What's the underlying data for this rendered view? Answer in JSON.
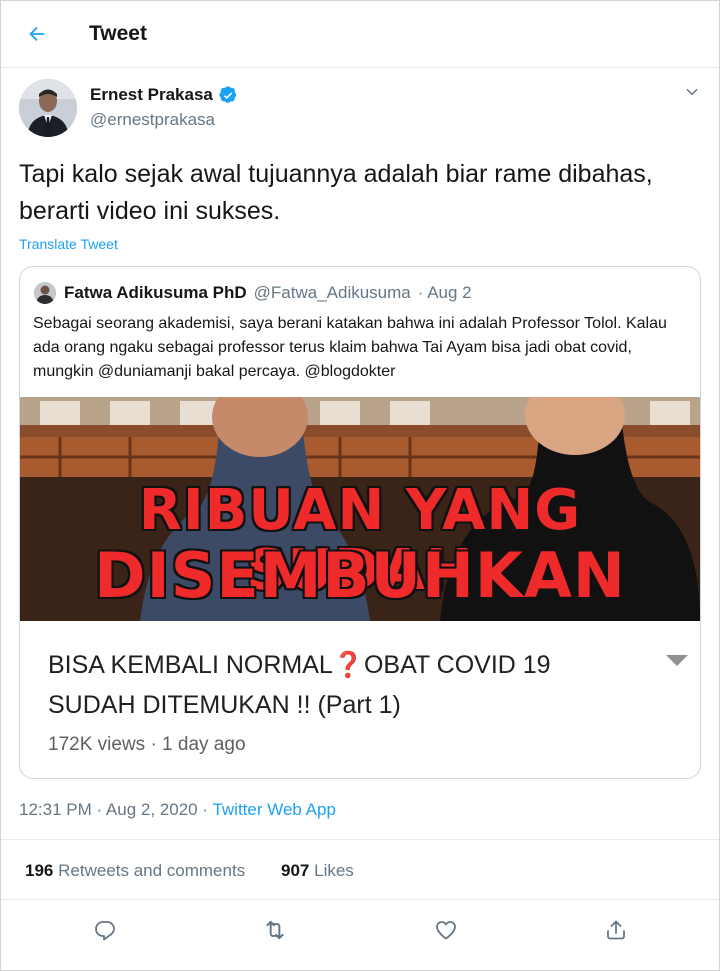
{
  "header": {
    "title": "Tweet"
  },
  "author": {
    "name": "Ernest Prakasa",
    "handle": "@ernestprakasa"
  },
  "tweet": {
    "text": "Tapi kalo sejak awal tujuannya adalah biar rame dibahas, berarti video ini sukses.",
    "translate_label": "Translate Tweet"
  },
  "quoted": {
    "name": "Fatwa Adikusuma PhD",
    "handle": "@Fatwa_Adikusuma",
    "date": "· Aug 2",
    "text": "Sebagai seorang akademisi, saya berani katakan bahwa ini adalah Professor Tolol. Kalau ada orang ngaku sebagai professor terus klaim bahwa Tai Ayam bisa jadi obat covid, mungkin @duniamanji bakal percaya. @blogdokter",
    "thumbnail_line1": "RIBUAN YANG SUDAH",
    "thumbnail_line2": "DISEMBUHKAN",
    "video_title": "BISA KEMBALI NORMAL❓OBAT COVID 19 SUDAH DITEMUKAN !!  (Part 1)",
    "video_meta": "172K views · 1 day ago"
  },
  "meta": {
    "timestamp": "12:31 PM · Aug 2, 2020 ·",
    "app": "Twitter Web App"
  },
  "stats": {
    "retweets_count": "196",
    "retweets_label": "Retweets and comments",
    "likes_count": "907",
    "likes_label": "Likes"
  },
  "colors": {
    "accent": "#1da1f2",
    "muted": "#657786",
    "thumbnail_text": "#ef2a2a"
  },
  "icons": [
    "back-arrow-icon",
    "verified-badge-icon",
    "chevron-down-icon",
    "reply-icon",
    "retweet-icon",
    "like-icon",
    "share-icon"
  ]
}
